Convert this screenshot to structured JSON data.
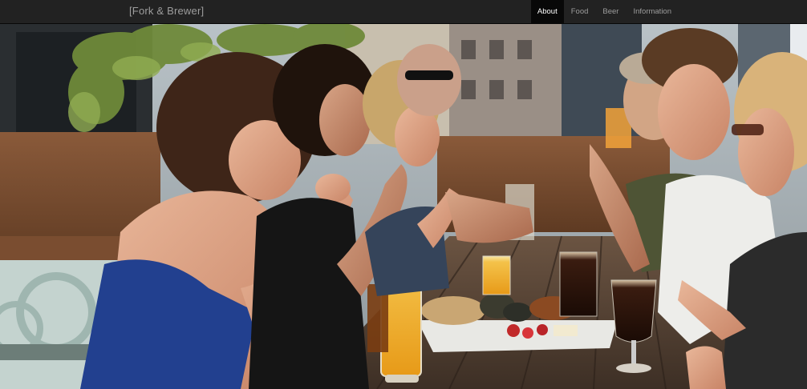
{
  "navbar": {
    "brand": "[Fork & Brewer]",
    "items": [
      {
        "label": "About",
        "active": true
      },
      {
        "label": "Food",
        "active": false
      },
      {
        "label": "Beer",
        "active": false
      },
      {
        "label": "Information",
        "active": false
      }
    ]
  },
  "hero": {
    "image_icon": "photo-group-dining-outdoors-icon"
  },
  "colors": {
    "navbar_bg": "#222222",
    "navbar_text": "#9d9d9d",
    "active_bg": "#080808",
    "active_text": "#ffffff"
  }
}
